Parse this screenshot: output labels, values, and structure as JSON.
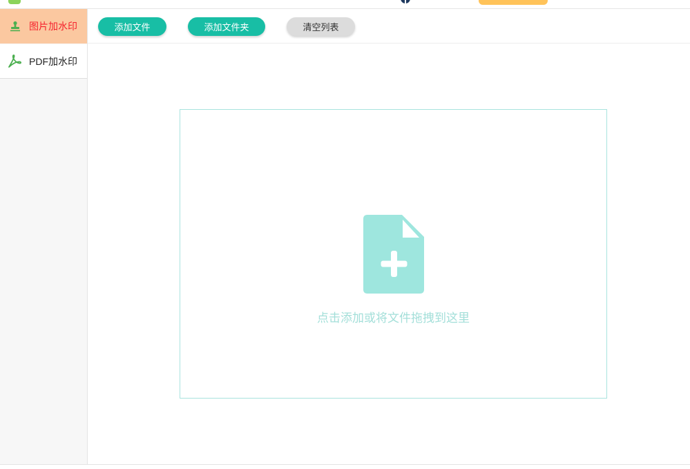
{
  "titlebar": {
    "logo_icon": "app-logo-icon",
    "avatar_icon": "user-avatar-icon",
    "accent_button_color": "#ffc35a"
  },
  "sidebar": {
    "items": [
      {
        "label": "图片加水印",
        "icon": "stamp-icon",
        "active": true
      },
      {
        "label": "PDF加水印",
        "icon": "pdf-icon",
        "active": false
      }
    ]
  },
  "toolbar": {
    "add_file": "添加文件",
    "add_folder": "添加文件夹",
    "clear_list": "清空列表"
  },
  "dropzone": {
    "icon": "file-add-icon",
    "hint": "点击添加或将文件拖拽到这里"
  },
  "colors": {
    "accent": "#18bea5",
    "active_item_bg": "#fbc8a0",
    "active_item_text": "#f5222d",
    "dropzone_tint": "#9ee6de",
    "secondary_button": "#dcdcdc"
  }
}
